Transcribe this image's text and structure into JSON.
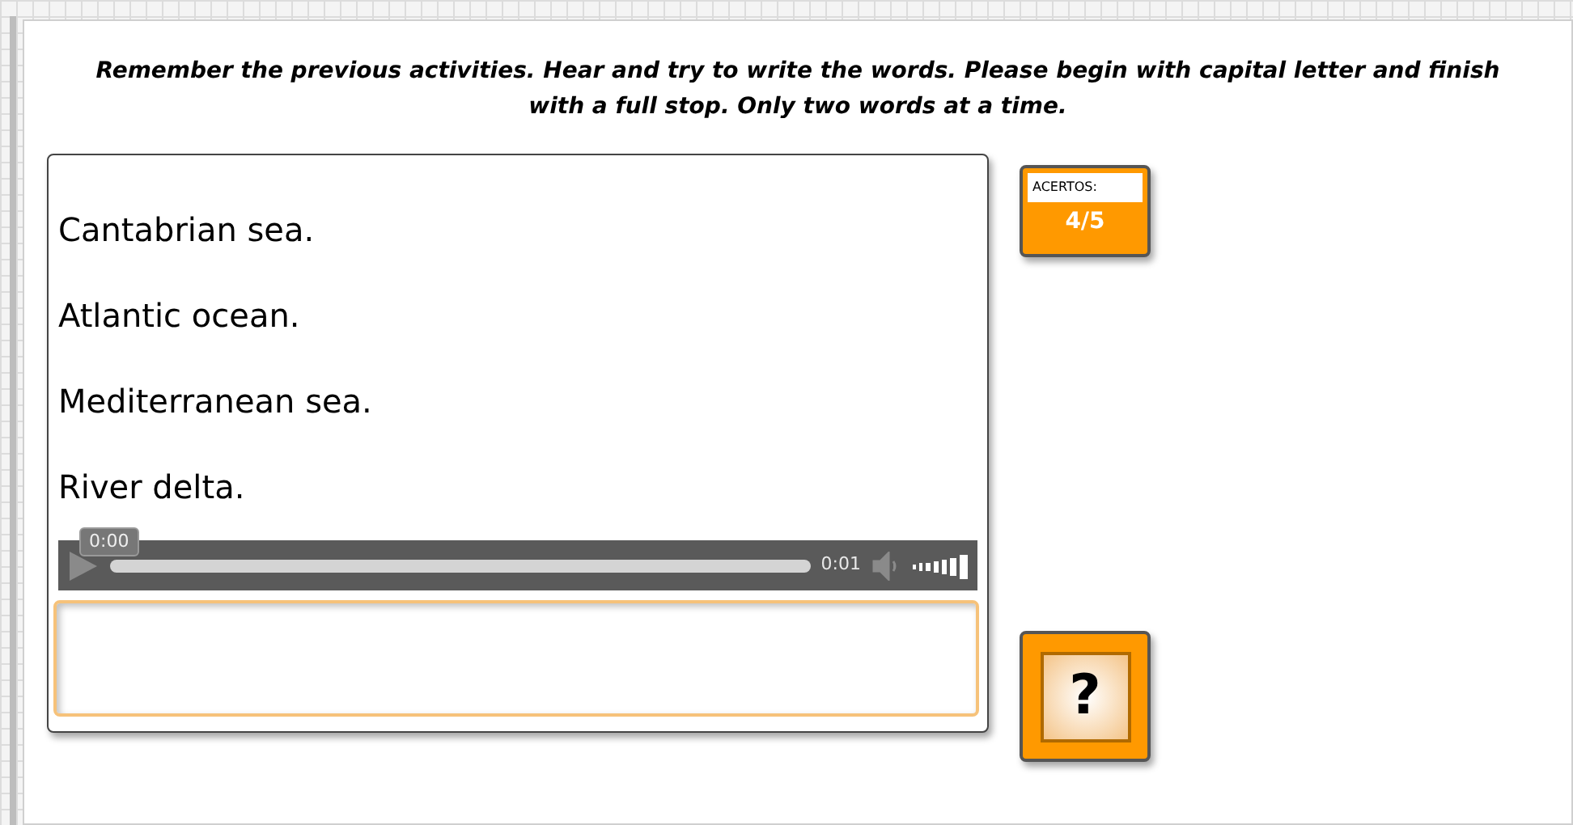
{
  "instructions": "Remember the previous activities. Hear and try to write the words. Please begin with capital letter and finish with a full stop. Only two words at a time.",
  "answers": [
    "Cantabrian sea.",
    "Atlantic ocean.",
    "Mediterranean sea.",
    "River delta."
  ],
  "player": {
    "tooltip": "0:00",
    "duration": "0:01"
  },
  "score": {
    "label": "ACERTOS:",
    "value": "4/5"
  },
  "help_button": {
    "label": "?"
  }
}
